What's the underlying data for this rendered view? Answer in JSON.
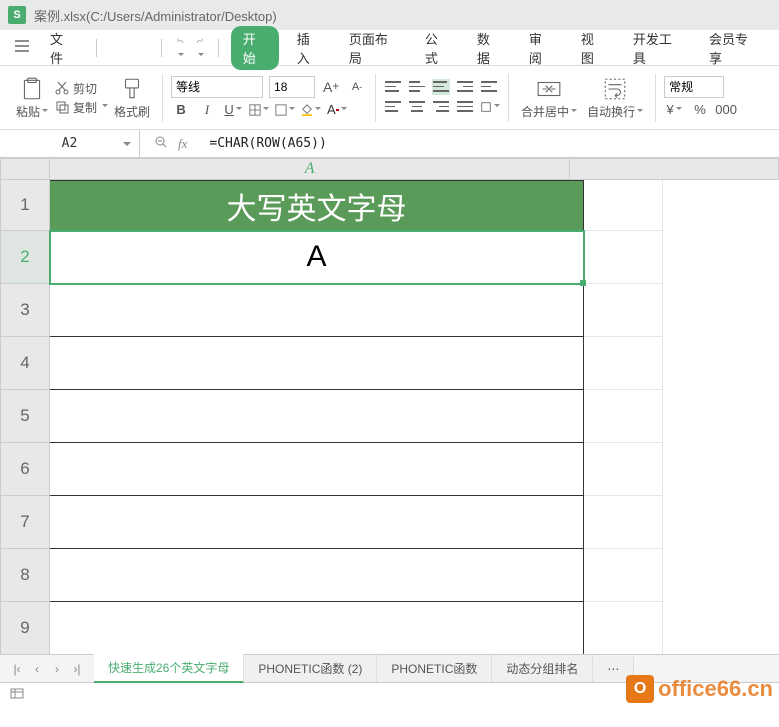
{
  "app": {
    "icon": "S",
    "title": "案例.xlsx(C:/Users/Administrator/Desktop)"
  },
  "menu": {
    "file": "文件",
    "tabs": [
      "开始",
      "插入",
      "页面布局",
      "公式",
      "数据",
      "审阅",
      "视图",
      "开发工具",
      "会员专享"
    ],
    "active_index": 0
  },
  "ribbon": {
    "paste": "粘贴",
    "cut": "剪切",
    "copy": "复制",
    "format_painter": "格式刷",
    "font_name": "等线",
    "font_size": "18",
    "bold": "B",
    "italic": "I",
    "underline": "U",
    "merge": "合并居中",
    "wrap": "自动换行",
    "number_format": "常规",
    "currency": "¥",
    "percent": "%"
  },
  "formula_bar": {
    "cell_ref": "A2",
    "fx": "fx",
    "formula": "=CHAR(ROW(A65))"
  },
  "sheet": {
    "col_header": "A",
    "row_headers": [
      "1",
      "2",
      "3",
      "4",
      "5",
      "6",
      "7",
      "8",
      "9"
    ],
    "header_cell": "大写英文字母",
    "active_cell_value": "A",
    "active_row": 2
  },
  "tabs": {
    "items": [
      "快速生成26个英文字母",
      "PHONETIC函数 (2)",
      "PHONETIC函数",
      "动态分组排名"
    ],
    "active_index": 0,
    "more": "⋯"
  },
  "watermark": {
    "badge": "O",
    "text": "office66.cn"
  }
}
